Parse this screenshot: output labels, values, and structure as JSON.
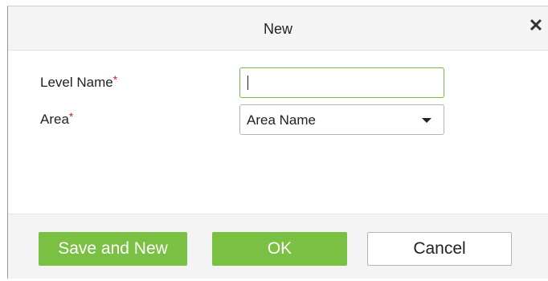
{
  "dialog": {
    "title": "New",
    "close_icon": "close-icon",
    "close_glyph": "✕"
  },
  "form": {
    "level_name": {
      "label": "Level Name",
      "required_mark": "*",
      "value": "",
      "placeholder": ""
    },
    "area": {
      "label": "Area",
      "required_mark": "*",
      "selected": "Area Name",
      "icon": "chevron-down-icon"
    }
  },
  "buttons": {
    "save_and_new": "Save and New",
    "ok": "OK",
    "cancel": "Cancel"
  },
  "colors": {
    "primary_green": "#7ac143",
    "focus_border": "#79b843",
    "required_red": "#e02020"
  }
}
